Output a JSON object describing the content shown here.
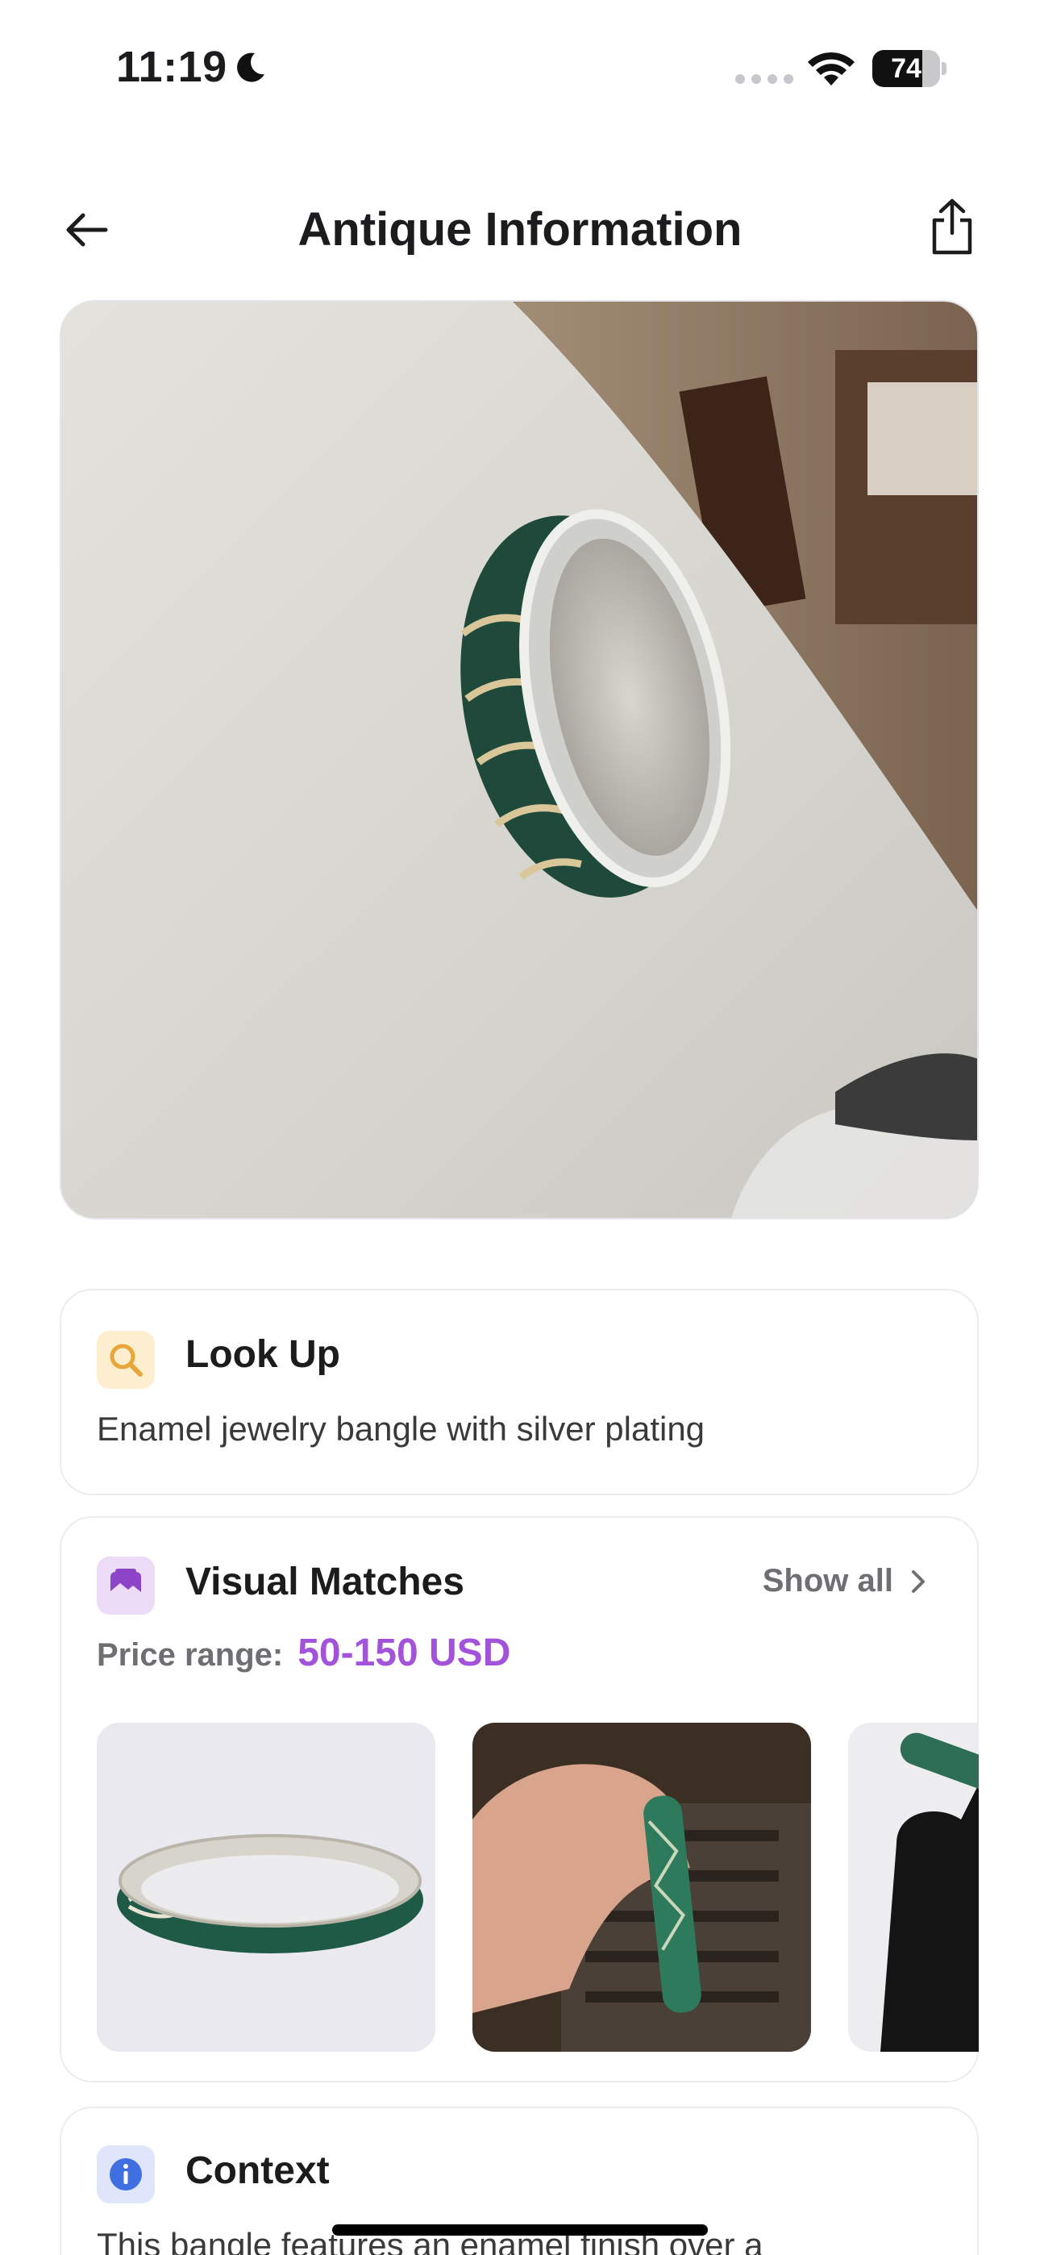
{
  "status_bar": {
    "time": "11:19",
    "battery_percent": "74",
    "battery_level": 0.74
  },
  "nav": {
    "title": "Antique Information"
  },
  "lookup": {
    "title": "Look Up",
    "text": "Enamel jewelry bangle with silver plating",
    "icon": "search-icon"
  },
  "matches": {
    "title": "Visual Matches",
    "show_all": "Show all",
    "price_label": "Price range:",
    "price_value": "50-150 USD",
    "icon": "image-gallery-icon"
  },
  "context": {
    "title": "Context",
    "text": "This bangle features an enamel finish over a",
    "icon": "info-icon"
  },
  "colors": {
    "accent_purple": "#a353d9",
    "lookup_icon_bg": "#fdeed0",
    "lookup_icon": "#e8a53a",
    "matches_icon_bg": "#ecdcf7",
    "matches_icon": "#8e44c9",
    "context_icon_bg": "#dfe6fb",
    "context_icon": "#3f6fe0"
  }
}
